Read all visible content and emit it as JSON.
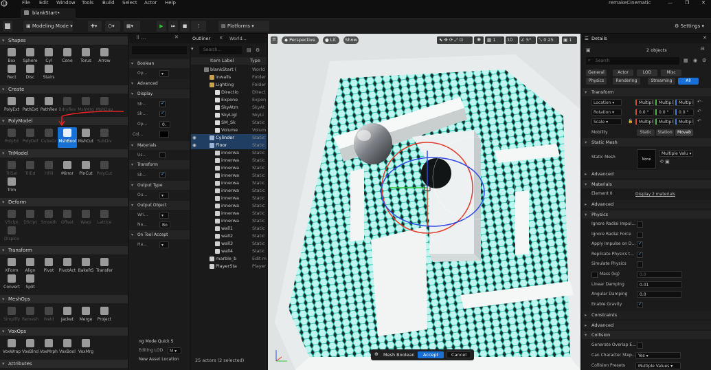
{
  "menu": [
    "File",
    "Edit",
    "Window",
    "Tools",
    "Build",
    "Select",
    "Actor",
    "Help"
  ],
  "app": {
    "tab_title": "blankStart•",
    "project": "remakeCinematic"
  },
  "toolbar": {
    "mode": "Modeling Mode",
    "platforms": "Platforms",
    "settings": "Settings"
  },
  "left": {
    "sections": {
      "shapes": {
        "label": "Shapes",
        "tools": [
          "Box",
          "Sphere",
          "Cyl",
          "Cone",
          "Torus",
          "Arrow",
          "Rect",
          "Disc",
          "Stairs"
        ]
      },
      "create": {
        "label": "Create",
        "tools": [
          "PolyExt",
          "PathExt",
          "PathRev",
          "BdryRev",
          "MshMrg",
          "MshDup"
        ]
      },
      "polymodel": {
        "label": "PolyModel",
        "tools": [
          "PolyEd",
          "PolyDef",
          "CubeGr",
          "MshBool",
          "MshCut",
          "SubDiv"
        ]
      },
      "trimodel": {
        "label": "TriModel",
        "tools": [
          "TriSel",
          "TriEd",
          "HFill",
          "Mirror",
          "PlnCut",
          "PolyCut",
          "Trim"
        ]
      },
      "deform": {
        "label": "Deform",
        "tools": [
          "VSclpt",
          "DSclpt",
          "Smooth",
          "Offset",
          "Warp",
          "Lattice",
          "Displce"
        ]
      },
      "transform": {
        "label": "Transform",
        "tools": [
          "XForm",
          "Align",
          "Pivot",
          "PivotAct",
          "BakeRS",
          "Transfer",
          "Convert",
          "Split"
        ]
      },
      "meshops": {
        "label": "MeshOps",
        "tools": [
          "Simplify",
          "Remesh",
          "Weld",
          "Jacket",
          "Merge",
          "Project"
        ]
      },
      "voxops": {
        "label": "VoxOps",
        "tools": [
          "VoxWrap",
          "VoxBlnd",
          "VoxMrph",
          "VoxBool",
          "VoxMrg"
        ]
      },
      "attributes": {
        "label": "Attributes"
      }
    }
  },
  "props": {
    "boolean": "Boolean",
    "op": "Op...",
    "advanced": "Advanced",
    "display": "Display",
    "sh": "Sh...",
    "op2": "Op...",
    "op_val": "0.",
    "col": "Col...",
    "materials": "Materials",
    "us": "Us...",
    "transform": "Transform",
    "output_type": "Output Type",
    "ou": "Ou...",
    "output_object": "Output Object",
    "wri": "Wri...",
    "na": "Na...",
    "na_val": "Bo",
    "on_tool_accept": "On Tool Accept",
    "ha": "Ha...",
    "quick": "ng Mode Quick S",
    "editing_lod": "Editing LOD",
    "lod_val": "M",
    "new_asset": "New Asset Location"
  },
  "outliner": {
    "tab": "Outliner",
    "tab2": "World...",
    "search_placeholder": "Search...",
    "col_label": "Item Label",
    "col_type": "Type",
    "rows": [
      {
        "label": "blankStart (",
        "type": "World"
      },
      {
        "label": "inwalls",
        "type": "Folder"
      },
      {
        "label": "Lighting",
        "type": "Folder"
      },
      {
        "label": "Directio",
        "type": "Direct"
      },
      {
        "label": "Expone",
        "type": "Expon"
      },
      {
        "label": "SkyAtm",
        "type": "SkyAt"
      },
      {
        "label": "SkyLigl",
        "type": "SkyLi"
      },
      {
        "label": "SM_Sk",
        "type": "Static"
      },
      {
        "label": "Volume",
        "type": "Volum"
      },
      {
        "label": "Cylinder",
        "type": "Static"
      },
      {
        "label": "Floor",
        "type": "Static"
      },
      {
        "label": "innerwa",
        "type": "Static"
      },
      {
        "label": "innerwa",
        "type": "Static"
      },
      {
        "label": "innerwa",
        "type": "Static"
      },
      {
        "label": "innerwa",
        "type": "Static"
      },
      {
        "label": "innerwa",
        "type": "Static"
      },
      {
        "label": "innerwa",
        "type": "Static"
      },
      {
        "label": "innerwa",
        "type": "Static"
      },
      {
        "label": "innerwa",
        "type": "Static"
      },
      {
        "label": "innerwa",
        "type": "Static"
      },
      {
        "label": "innerwa",
        "type": "Static"
      },
      {
        "label": "wall1",
        "type": "Static"
      },
      {
        "label": "wall2",
        "type": "Static"
      },
      {
        "label": "wall3",
        "type": "Static"
      },
      {
        "label": "wall4",
        "type": "Static"
      },
      {
        "label": "marble_b",
        "type": "Edit m"
      },
      {
        "label": "PlayerSta",
        "type": "Player"
      }
    ],
    "footer": "25 actors (2 selected)"
  },
  "viewport": {
    "perspective": "Perspective",
    "lit": "Lit",
    "show": "Show",
    "grid": "10",
    "angle": "5°",
    "scale": "0.25",
    "cam": "1",
    "tool_label": "Mesh Boolean",
    "accept": "Accept",
    "cancel": "Cancel"
  },
  "details": {
    "tab": "Details",
    "count": "2 objects",
    "search_placeholder": "Search",
    "filters": [
      "General",
      "Actor",
      "LOD",
      "Misc",
      "Physics",
      "Rendering",
      "Streaming",
      "All"
    ],
    "transform": "Transform",
    "location": "Location",
    "rotation": "Rotation",
    "scale": "Scale",
    "multi": "Multipl",
    "rot_val": "0.0 °",
    "mobility": "Mobility",
    "mob_opts": [
      "Static",
      "Station",
      "Movab"
    ],
    "static_mesh_hdr": "Static Mesh",
    "static_mesh": "Static Mesh",
    "mesh_none": "None",
    "mesh_val": "Multiple Valu",
    "advanced": "Advanced",
    "materials": "Materials",
    "element0": "Element 0",
    "element0_val": "Display 2 materials",
    "physics": "Physics",
    "phys_rows": [
      "Ignore Radial Impul...",
      "Ignore Radial Force",
      "Apply Impulse on D...",
      "Replicate Physics t...",
      "Simulate Physics",
      "Mass (kg)",
      "Linear Damping",
      "Angular Damping",
      "Enable Gravity"
    ],
    "mass_val": "0.0",
    "lin_val": "0.01",
    "ang_val": "0.0",
    "constraints": "Constraints",
    "collision": "Collision",
    "gen_overlap": "Generate Overlap E...",
    "char_step": "Can Character Step...",
    "char_val": "Yes",
    "presets": "Collision Presets",
    "presets_val": "Multiple Values"
  },
  "colors": {
    "accent": "#1670d6",
    "hex": "#4fe0d0"
  }
}
